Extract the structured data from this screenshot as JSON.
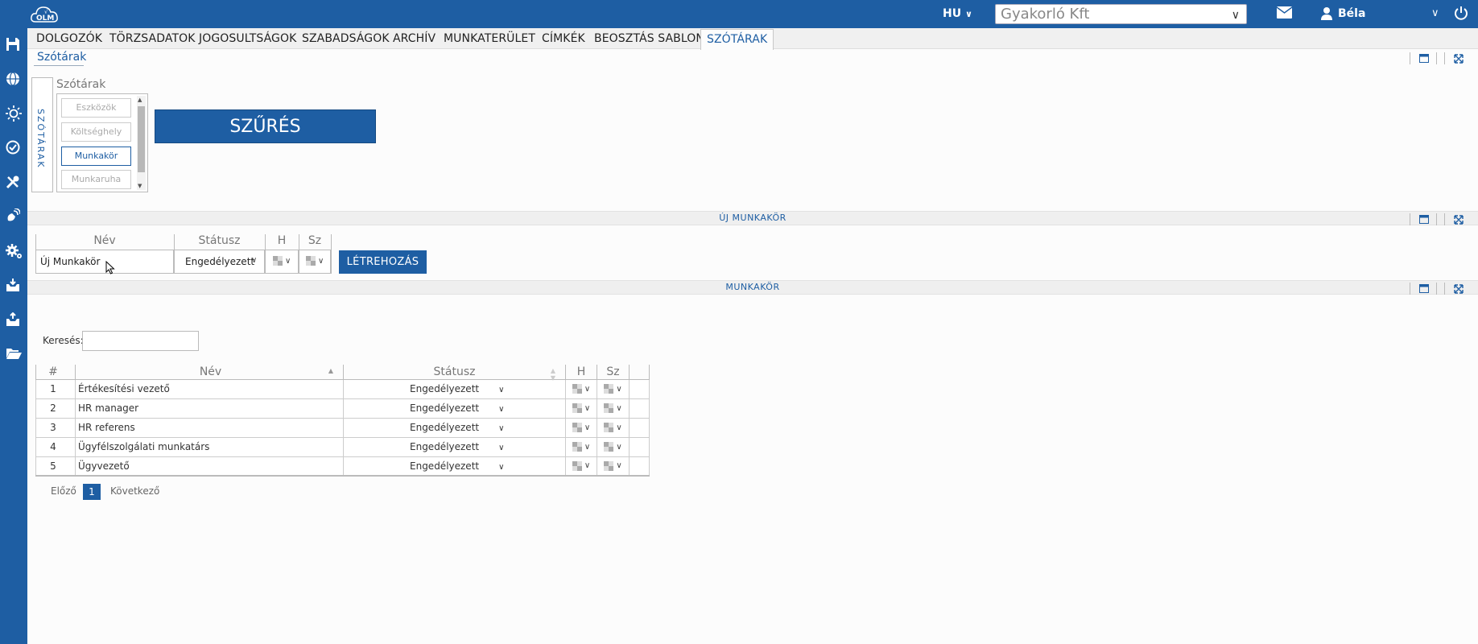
{
  "topbar": {
    "logo_text": "OLM",
    "language": "HU",
    "company": "Gyakorló Kft",
    "user_name": "Béla"
  },
  "tabs": [
    {
      "label": "DOLGOZÓK"
    },
    {
      "label": "TÖRZSADATOK"
    },
    {
      "label": "JOGOSULTSÁGOK"
    },
    {
      "label": "SZABADSÁGOK"
    },
    {
      "label": "ARCHÍV"
    },
    {
      "label": "MUNKATERÜLET"
    },
    {
      "label": "CÍMKÉK"
    },
    {
      "label": "BEOSZTÁS SABLON"
    },
    {
      "label": "SZÓTÁRAK",
      "active": true
    }
  ],
  "breadcrumb": "Szótárak",
  "filter": {
    "vertical_label": "SZÓTÁRAK",
    "list_label": "Szótárak",
    "items": [
      "Eszközök",
      "Költséghely",
      "Munkakör",
      "Munkaruha"
    ],
    "selected": "Munkakör",
    "button": "SZŰRÉS"
  },
  "new_section": {
    "title": "ÚJ MUNKAKÖR",
    "headers": {
      "name": "Név",
      "status": "Státusz",
      "h": "H",
      "sz": "Sz"
    },
    "name_value": "Új Munkakör",
    "status_value": "Engedélyezett",
    "create_button": "LÉTREHOZÁS"
  },
  "list_section": {
    "title": "MUNKAKÖR",
    "search_label": "Keresés:",
    "search_value": "",
    "columns": {
      "num": "#",
      "name": "Név",
      "status": "Státusz",
      "h": "H",
      "sz": "Sz"
    },
    "rows": [
      {
        "num": "1",
        "name": "Értékesítési vezető",
        "status": "Engedélyezett"
      },
      {
        "num": "2",
        "name": "HR manager",
        "status": "Engedélyezett"
      },
      {
        "num": "3",
        "name": "HR referens",
        "status": "Engedélyezett"
      },
      {
        "num": "4",
        "name": "Ügyfélszolgálati munkatárs",
        "status": "Engedélyezett"
      },
      {
        "num": "5",
        "name": "Ügyvezető",
        "status": "Engedélyezett"
      }
    ],
    "pager": {
      "prev": "Előző",
      "current": "1",
      "next": "Következő"
    }
  },
  "colors": {
    "brand": "#1e5ea3",
    "background": "#fcfcfc"
  }
}
